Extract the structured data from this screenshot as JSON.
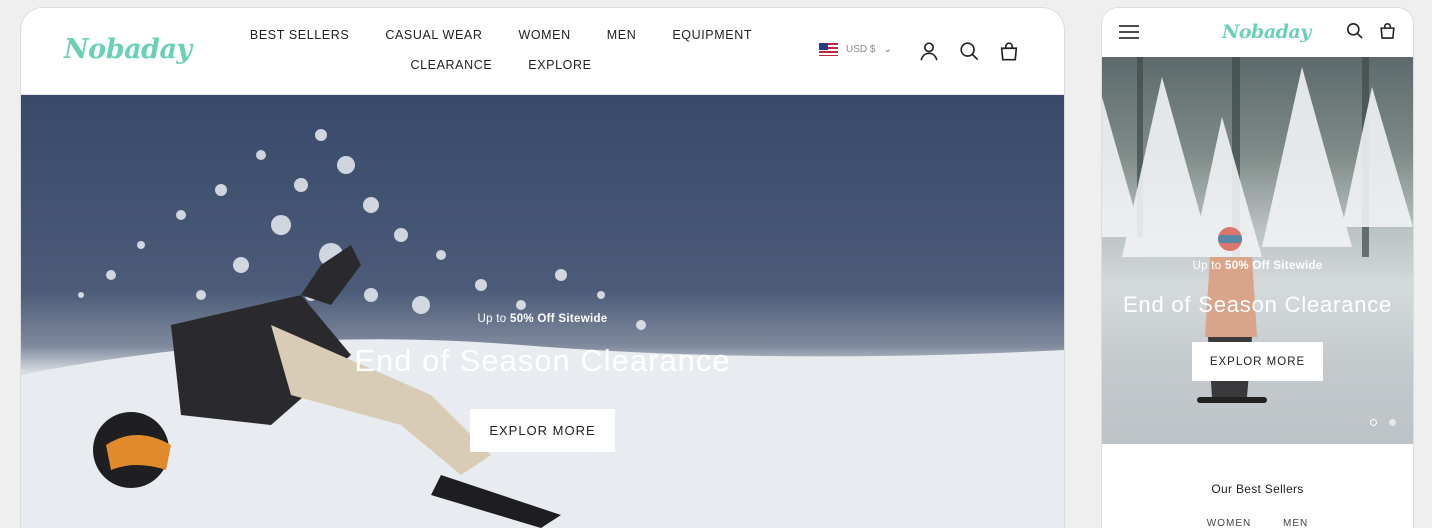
{
  "desktop": {
    "logo": "Nobaday",
    "nav": [
      "BEST SELLERS",
      "CASUAL WEAR",
      "WOMEN",
      "MEN",
      "EQUIPMENT",
      "CLEARANCE",
      "EXPLORE"
    ],
    "currency": "USD $",
    "hero": {
      "subtitle_prefix": "Up to ",
      "subtitle_bold": "50% Off Sitewide",
      "title": "End of Season Clearance",
      "button": "EXPLOR MORE"
    }
  },
  "mobile": {
    "logo": "Nobaday",
    "hero": {
      "subtitle_prefix": "Up to ",
      "subtitle_bold": "50% Off Sitewide",
      "title": "End of Season Clearance",
      "button": "EXPLOR MORE",
      "slides": 2,
      "active_slide": 1
    },
    "section_title": "Our Best Sellers",
    "tabs": [
      "WOMEN",
      "MEN"
    ]
  },
  "colors": {
    "brand": "#6bd0b8"
  },
  "icons": [
    "account-icon",
    "search-icon",
    "cart-icon",
    "menu-icon",
    "chevron-down-icon"
  ]
}
